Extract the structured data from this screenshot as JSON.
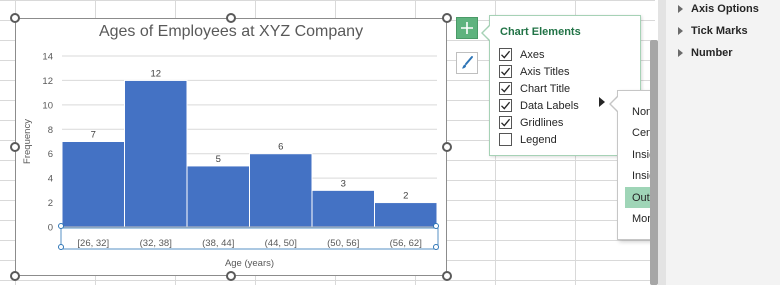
{
  "chart_data": {
    "type": "bar",
    "title": "Ages of Employees at XYZ Company",
    "xlabel": "Age (years)",
    "ylabel": "Frequency",
    "categories": [
      "[26, 32]",
      "(32, 38]",
      "(38, 44]",
      "(44, 50]",
      "(50, 56]",
      "(56, 62]"
    ],
    "values": [
      7,
      12,
      5,
      6,
      3,
      2
    ],
    "data_labels": [
      "7",
      "12",
      "5",
      "6",
      "3",
      "2"
    ],
    "ylim": [
      0,
      14
    ],
    "yticks": [
      0,
      2,
      4,
      6,
      8,
      10,
      12,
      14
    ],
    "ytick_labels": [
      "0",
      "2",
      "4",
      "6",
      "8",
      "10",
      "12",
      "14"
    ],
    "grid": true,
    "legend": false,
    "bar_color": "#4472c4"
  },
  "chart_buttons": {
    "elements_icon": "plus-icon",
    "styles_icon": "brush-icon",
    "accent": "#5eb37e"
  },
  "chart_elements": {
    "title": "Chart Elements",
    "items": [
      {
        "label": "Axes",
        "checked": true
      },
      {
        "label": "Axis Titles",
        "checked": true
      },
      {
        "label": "Chart Title",
        "checked": true
      },
      {
        "label": "Data Labels",
        "checked": true
      },
      {
        "label": "Gridlines",
        "checked": true
      },
      {
        "label": "Legend",
        "checked": false
      }
    ]
  },
  "data_label_menu": {
    "items": [
      {
        "label": "None",
        "selected": false
      },
      {
        "label": "Center",
        "selected": false
      },
      {
        "label": "Inside End",
        "selected": false
      },
      {
        "label": "Inside Base",
        "selected": false
      },
      {
        "label": "Outside End",
        "selected": true
      },
      {
        "label": "More Data Label Options...",
        "selected": false
      }
    ],
    "highlight_color": "#9fd5b7"
  },
  "format_pane": {
    "items": [
      "Axis Options",
      "Tick Marks",
      "Number"
    ]
  }
}
